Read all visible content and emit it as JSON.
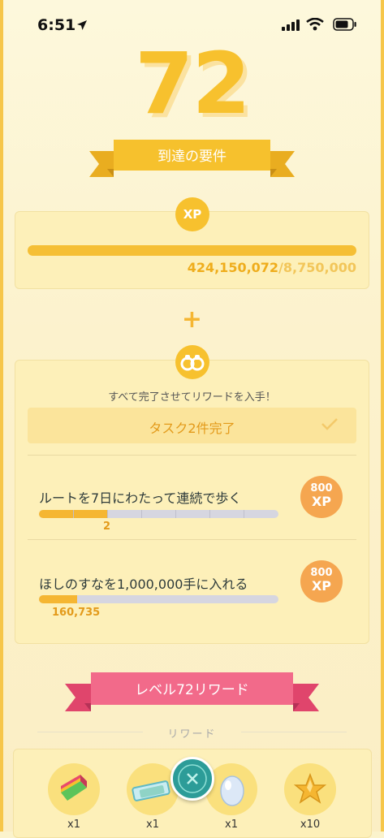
{
  "status_bar": {
    "time": "6:51"
  },
  "level": {
    "value": "72"
  },
  "requirements": {
    "title": "到達の要件"
  },
  "xp": {
    "badge": "XP",
    "current": "424,150,072",
    "separator": "/",
    "required": "8,750,000",
    "progress": 1.0
  },
  "plus": "+",
  "tasks": {
    "intro": "すべて完了させてリワードを入手！",
    "banner": "タスク2件完了",
    "items": [
      {
        "title": "ルートを7日にわたって連続で歩く",
        "progress_label": "2",
        "progress": 0.2857,
        "reward_value": "800",
        "reward_unit": "XP"
      },
      {
        "title": "ほしのすなを1,000,000手に入れる",
        "progress_label": "160,735",
        "progress": 0.16,
        "reward_value": "800",
        "reward_unit": "XP"
      }
    ]
  },
  "rewards": {
    "banner": "レベル72リワード",
    "label": "リワード",
    "items": [
      {
        "icon": "rare-candy-icon",
        "qty": "x1"
      },
      {
        "icon": "incubator-ticket-icon",
        "qty": "x1"
      },
      {
        "icon": "egg-icon",
        "qty": "x1"
      },
      {
        "icon": "stardust-star-icon",
        "qty": "x10"
      }
    ]
  },
  "colors": {
    "gold": "#f7c12e",
    "pink": "#f26a8a",
    "teal": "#2c9c98",
    "orange_badge": "#f5a650"
  }
}
